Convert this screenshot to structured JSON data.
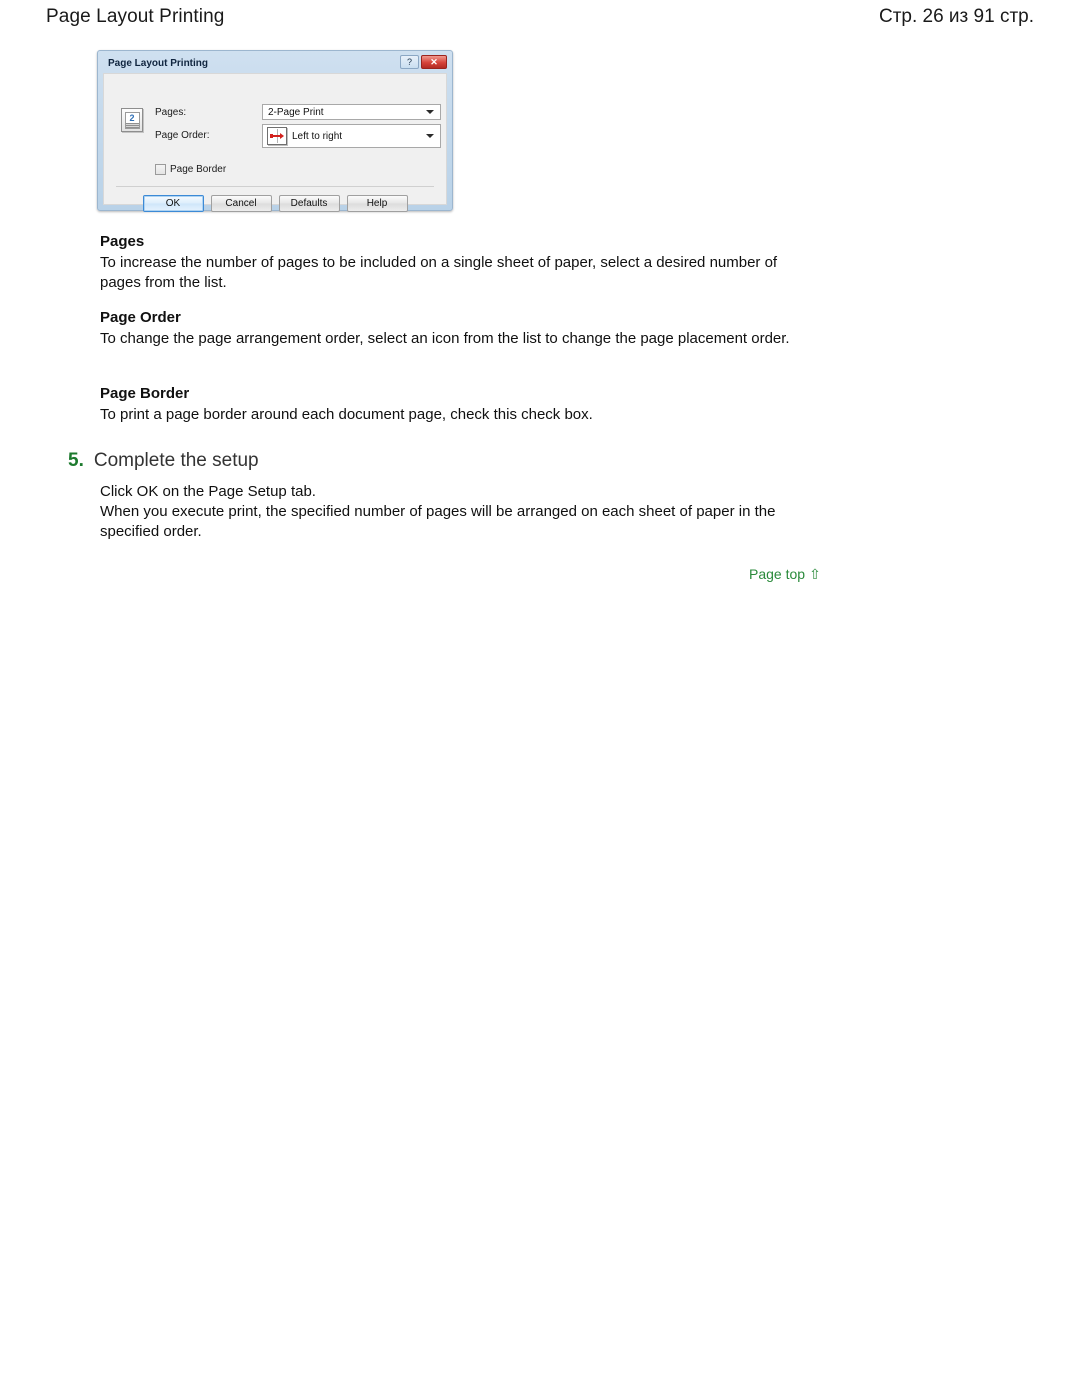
{
  "header": {
    "title": "Page Layout Printing",
    "page_indicator": "Стр. 26 из 91 стр."
  },
  "dialog": {
    "title": "Page Layout Printing",
    "help_button": "?",
    "close_button": "✕",
    "preview_icon_number": "2",
    "labels": {
      "pages": "Pages:",
      "page_order": "Page Order:"
    },
    "pages_value": "2-Page Print",
    "page_order_value": "Left to right",
    "page_border_label": "Page Border",
    "page_border_checked": false,
    "buttons": {
      "ok": "OK",
      "cancel": "Cancel",
      "defaults": "Defaults",
      "help": "Help"
    }
  },
  "sections": [
    {
      "heading": "Pages",
      "body": "To increase the number of pages to be included on a single sheet of paper, select a desired number of pages from the list."
    },
    {
      "heading": "Page Order",
      "body": "To change the page arrangement order, select an icon from the list to change the page placement order."
    },
    {
      "heading": "Page Border",
      "body": "To print a page border around each document page, check this check box."
    }
  ],
  "step": {
    "number": "5.",
    "title": "Complete the setup",
    "body_line_1": "Click OK on the Page Setup tab.",
    "body_line_2": "When you execute print, the specified number of pages will be arranged on each sheet of paper in the specified order."
  },
  "page_top_link": {
    "label": "Page top",
    "arrow": "⇧",
    "color": "#2a8a3b"
  }
}
